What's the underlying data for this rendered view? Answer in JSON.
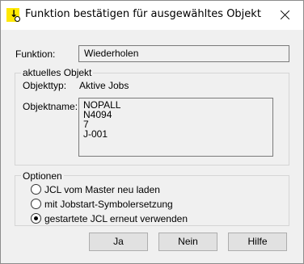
{
  "window": {
    "title": "Funktion bestätigen für ausgewähltes Objekt",
    "app_icon": "yellow-arrow-icon"
  },
  "funktion": {
    "label": "Funktion:",
    "value": "Wiederholen"
  },
  "objekt_group": {
    "title": "aktuelles Objekt",
    "objekttyp_label": "Objekttyp:",
    "objekttyp_value": "Aktive Jobs",
    "objektname_label": "Objektname:",
    "objektname_lines": [
      "NOPALL",
      "N4094",
      "7",
      "J-001"
    ]
  },
  "optionen_group": {
    "title": "Optionen",
    "options": [
      {
        "label": "JCL vom Master neu laden",
        "checked": false
      },
      {
        "label": "mit Jobstart-Symbolersetzung",
        "checked": false
      },
      {
        "label": "gestartete JCL erneut verwenden",
        "checked": true
      }
    ]
  },
  "buttons": {
    "ja": "Ja",
    "nein": "Nein",
    "hilfe": "Hilfe"
  }
}
